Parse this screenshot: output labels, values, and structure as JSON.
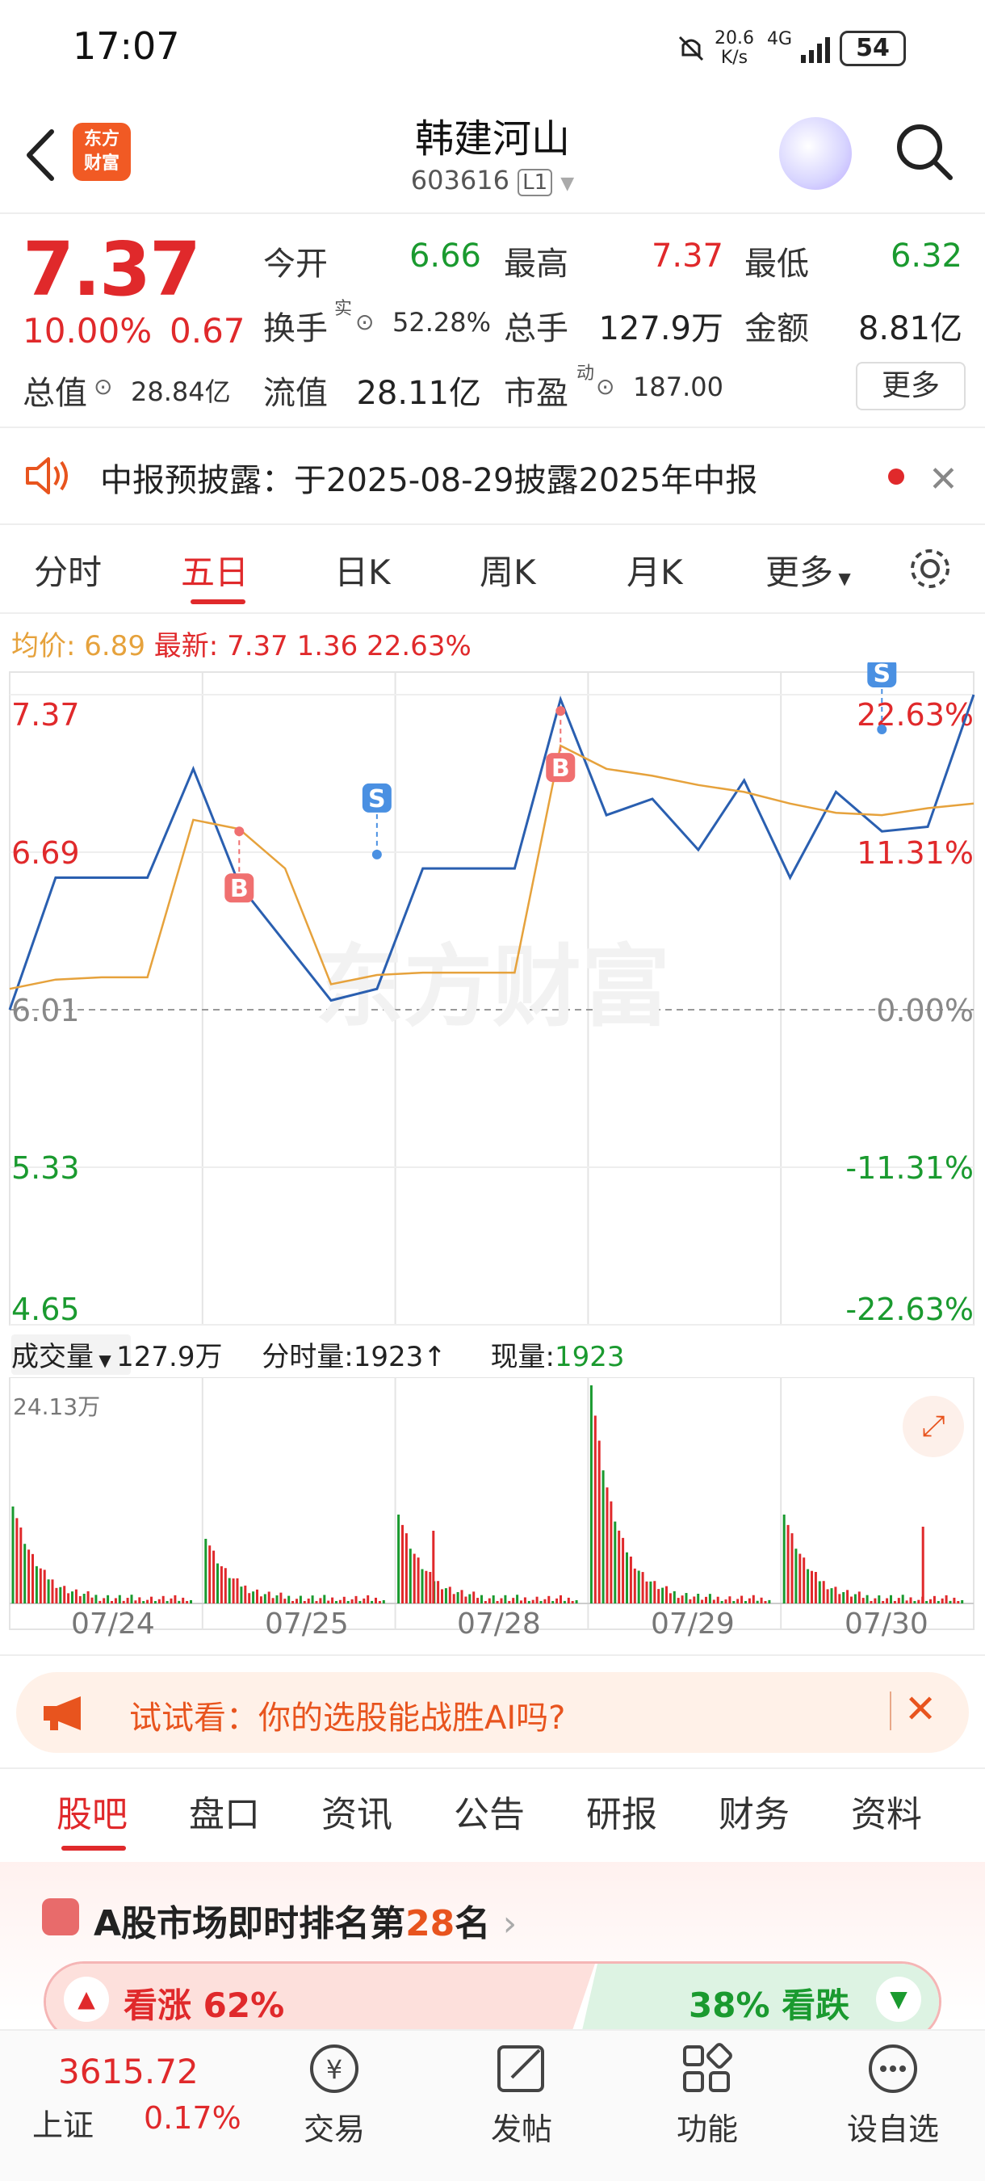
{
  "status_bar": {
    "time": "17:07",
    "net_speed": "20.6",
    "net_unit": "K/s",
    "network": "4G",
    "battery": "54"
  },
  "header": {
    "logo": "东方财富",
    "stock_name": "韩建河山",
    "stock_code": "603616",
    "level": "L1"
  },
  "quote": {
    "price": "7.37",
    "change_pct": "10.00%",
    "change": "0.67",
    "open_label": "今开",
    "open": "6.66",
    "high_label": "最高",
    "high": "7.37",
    "low_label": "最低",
    "low": "6.32",
    "turnover_label": "换手",
    "turnover_sup": "实",
    "turnover": "52.28%",
    "volume_label": "总手",
    "volume": "127.9万",
    "amount_label": "金额",
    "amount": "8.81亿",
    "mktcap_label": "总值",
    "mktcap": "28.84亿",
    "float_label": "流值",
    "float": "28.11亿",
    "pe_label": "市盈",
    "pe_sup": "动",
    "pe": "187.00",
    "more": "更多"
  },
  "notice": {
    "text": "中报预披露：于2025-08-29披露2025年中报"
  },
  "chart_tabs": [
    "分时",
    "五日",
    "日K",
    "周K",
    "月K",
    "更多"
  ],
  "legend": {
    "avg_label": "均价:",
    "avg": "6.89",
    "latest_label": "最新:",
    "latest": "7.37",
    "latest_chg": "1.36",
    "latest_pct": "22.63%"
  },
  "chart_data": {
    "type": "line",
    "x": [
      "07/24",
      "07/25",
      "07/28",
      "07/29",
      "07/30"
    ],
    "ylim": [
      4.65,
      7.37
    ],
    "y_ticks_left": [
      "7.37",
      "6.69",
      "6.01",
      "5.33",
      "4.65"
    ],
    "y_ticks_right": [
      "22.63%",
      "11.31%",
      "0.00%",
      "-11.31%",
      "-22.63%"
    ],
    "series": [
      {
        "color": "#2a5fb0",
        "values": [
          6.01,
          6.58,
          6.58,
          6.58,
          7.05,
          6.55,
          6.3,
          6.05,
          6.1,
          6.62,
          6.62,
          6.62,
          7.35,
          6.85,
          6.92,
          6.7,
          7.0,
          6.58,
          6.95,
          6.78,
          6.8,
          7.37
        ]
      },
      {
        "color": "#e6a23c",
        "values": [
          6.1,
          6.14,
          6.15,
          6.15,
          6.83,
          6.79,
          6.62,
          6.12,
          6.16,
          6.17,
          6.17,
          6.17,
          7.15,
          7.05,
          7.02,
          6.98,
          6.95,
          6.9,
          6.86,
          6.85,
          6.88,
          6.9
        ]
      }
    ],
    "markers": [
      {
        "label": "B",
        "x_index": 5,
        "value": 6.78
      },
      {
        "label": "S",
        "x_index": 8,
        "value": 6.68
      },
      {
        "label": "B",
        "x_index": 12,
        "value": 7.3
      },
      {
        "label": "S",
        "x_index": 19,
        "value": 7.22
      }
    ]
  },
  "volume": {
    "selector": "成交量",
    "total": "127.9万",
    "tick_label": "分时量:1923↑",
    "current_label": "现量:",
    "current": "1923",
    "max_label": "24.13万"
  },
  "ai_banner": {
    "text": "试试看：你的选股能战胜AI吗?"
  },
  "bottom_tabs": [
    "股吧",
    "盘口",
    "资讯",
    "公告",
    "研报",
    "财务",
    "资料"
  ],
  "ranking": {
    "prefix": "A股市场即时排名第",
    "rank": "28",
    "suffix": "名",
    "up_label": "看涨 62%",
    "down_label": "38% 看跌"
  },
  "bottom_nav": {
    "index_value": "3615.72",
    "index_name": "上证",
    "index_pct": "0.17%",
    "items": [
      "交易",
      "发帖",
      "功能",
      "设自选"
    ]
  },
  "colors": {
    "up": "#e0292b",
    "down": "#1a9a2f",
    "accent": "#e8541e",
    "line": "#2a5fb0",
    "avg": "#e6a23c"
  }
}
